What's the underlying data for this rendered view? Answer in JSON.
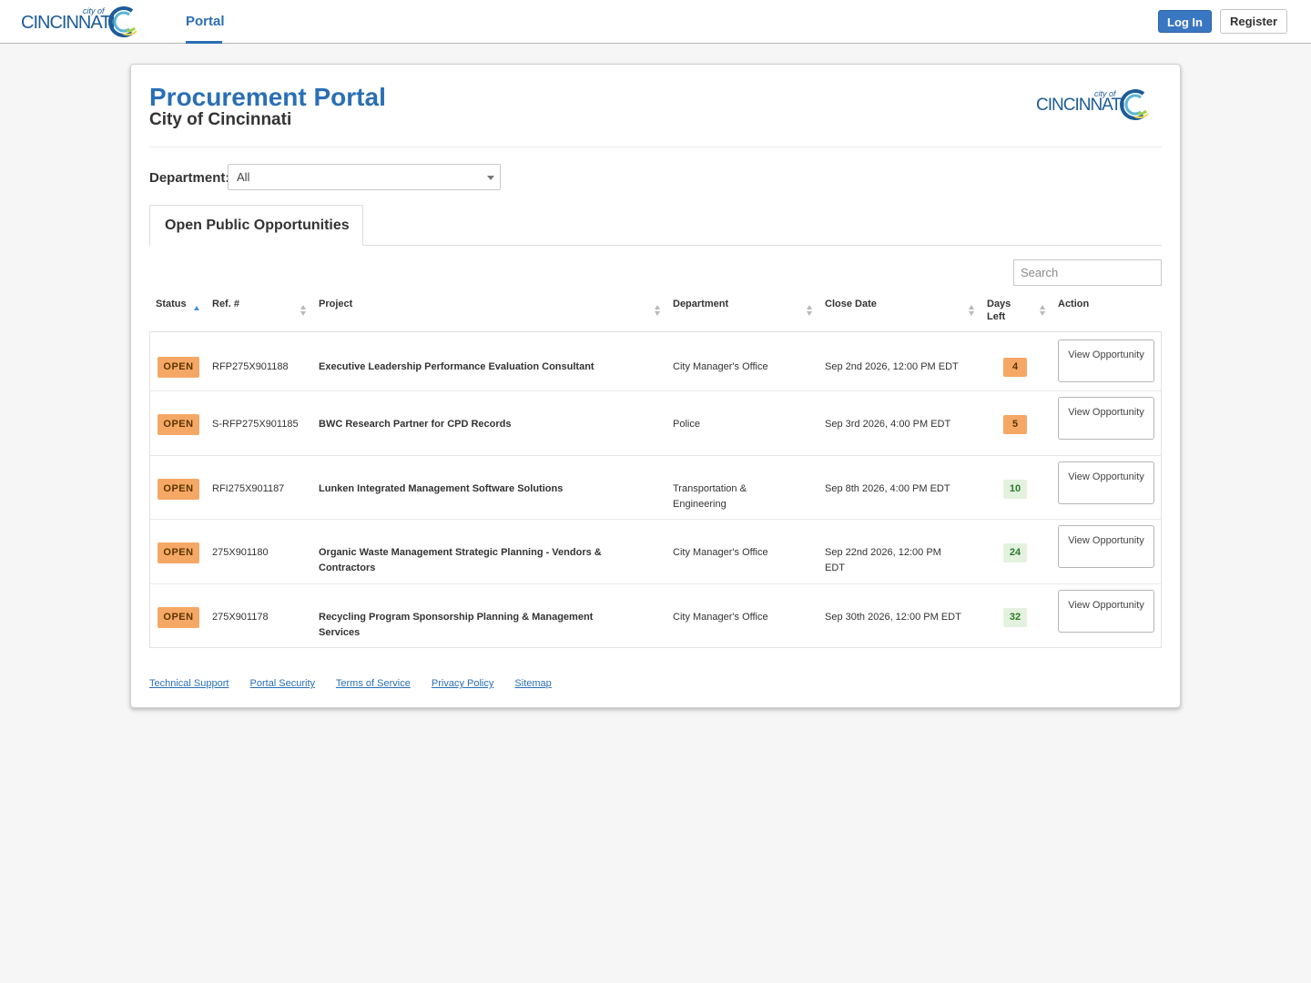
{
  "brand": {
    "logo_word": "CINCINNATI",
    "logo_small": "city of"
  },
  "nav": {
    "portal_tab": "Portal",
    "login": "Log In",
    "register": "Register"
  },
  "header": {
    "title": "Procurement Portal",
    "subtitle": "City of Cincinnati"
  },
  "filter": {
    "label": "Department:",
    "selected": "All"
  },
  "tabs": [
    {
      "label": "Open Public Opportunities"
    }
  ],
  "search": {
    "placeholder": "Search"
  },
  "table": {
    "columns": [
      "Status",
      "Ref. #",
      "Project",
      "Department",
      "Close Date",
      "Days Left",
      "Action"
    ],
    "rows": [
      {
        "status": "OPEN",
        "ref": "RFP275X901188",
        "project": "Executive Leadership Performance Evaluation Consultant",
        "department": "City Manager's Office",
        "close_date": "Sep 2nd 2026, 12:00 PM EDT",
        "days_left": "4",
        "action": "View Opportunity"
      },
      {
        "status": "OPEN",
        "ref": "S-RFP275X901185",
        "project": "BWC Research Partner for CPD Records",
        "department": "Police",
        "close_date": "Sep 3rd 2026, 4:00 PM EDT",
        "days_left": "5",
        "action": "View Opportunity"
      },
      {
        "status": "OPEN",
        "ref": "RFI275X901187",
        "project": "Lunken Integrated Management Software Solutions",
        "department": "Transportation & Engineering",
        "close_date": "Sep 8th 2026, 4:00 PM EDT",
        "days_left": "10",
        "action": "View Opportunity"
      },
      {
        "status": "OPEN",
        "ref": "275X901180",
        "project": "Organic Waste Management Strategic Planning - Vendors & Contractors",
        "department": "City Manager's Office",
        "close_date": "Sep 22nd 2026, 12:00 PM EDT",
        "days_left": "24",
        "action": "View Opportunity"
      },
      {
        "status": "OPEN",
        "ref": "275X901178",
        "project": "Recycling Program Sponsorship Planning & Management Services",
        "department": "City Manager's Office",
        "close_date": "Sep 30th 2026, 12:00 PM EDT",
        "days_left": "32",
        "action": "View Opportunity"
      }
    ]
  },
  "footer": {
    "links": [
      "Technical Support",
      "Portal Security",
      "Terms of Service",
      "Privacy Policy",
      "Sitemap"
    ]
  },
  "colors": {
    "brand_blue": "#2a6fb5",
    "open_badge": "#f5a865",
    "days_ok": "#e3f2de",
    "login_button": "#3a77c2"
  }
}
